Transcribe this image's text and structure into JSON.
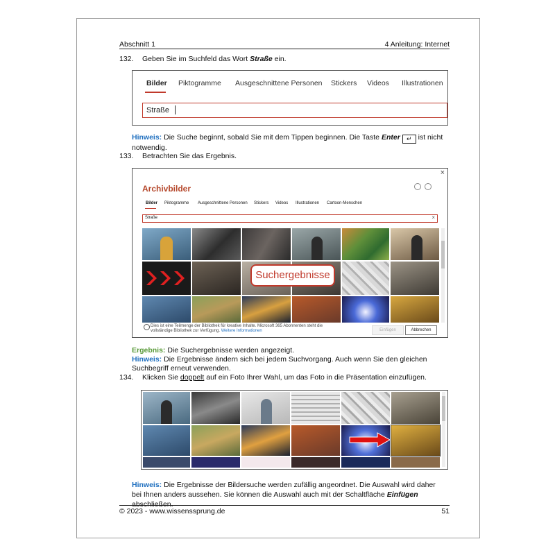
{
  "header": {
    "left": "Abschnitt 1",
    "right": "4 Anleitung: Internet"
  },
  "step132": {
    "num": "132.",
    "text_before": "Geben Sie im Suchfeld das Wort ",
    "bold_word": "Straße",
    "text_after": " ein."
  },
  "screen1": {
    "tabs": [
      "Bilder",
      "Piktogramme",
      "Ausgeschnittene Personen",
      "Stickers",
      "Videos",
      "Illustrationen"
    ],
    "search_value": "Straße"
  },
  "hint1": {
    "label": "Hinweis:",
    "text_before": " Die Suche beginnt, sobald Sie mit dem Tippen beginnen. Die Taste ",
    "key_word": "Enter",
    "key_symbol": "↵",
    "text_after": " ist nicht notwendig."
  },
  "step133": {
    "num": "133.",
    "text": "Betrachten Sie das Ergebnis."
  },
  "screen2": {
    "title": "Archivbilder",
    "close": "×",
    "tabs": [
      "Bilder",
      "Piktogramme",
      "Ausgeschnittene Personen",
      "Stickers",
      "Videos",
      "Illustrationen",
      "Cartoon-Menschen"
    ],
    "search_value": "Straße",
    "search_clear": "×",
    "callout": "Suchergebnisse",
    "footer_info": "Dies ist eine Teilmenge der Bibliothek für kreative Inhalte. Microsoft 365 Abonnenten steht die vollständige Bibliothek zur Verfügung.",
    "footer_link": "Weitere Informationen",
    "insert_button": "Einfügen",
    "cancel_button": "Abbrechen"
  },
  "result": {
    "label": "Ergebnis:",
    "text": " Die Suchergebnisse werden angezeigt."
  },
  "hint2": {
    "label": "Hinweis:",
    "text": " Die Ergebnisse ändern sich bei jedem Suchvorgang. Auch wenn Sie den gleichen Suchbegriff erneut verwenden."
  },
  "step134": {
    "num": "134.",
    "text_before": "Klicken Sie ",
    "underlined": "doppelt",
    "text_after": " auf ein Foto Ihrer Wahl, um das Foto in die Präsentation einzufügen."
  },
  "hint3": {
    "label": "Hinweis:",
    "text_before": " Die Ergebnisse der Bildersuche werden zufällig angeordnet. Die Auswahl wird daher bei Ihnen anders aussehen. Sie können die Auswahl auch mit der Schaltfläche ",
    "bold_word": "Einfügen",
    "text_after": " abschließen."
  },
  "footer": {
    "left": "© 2023 - www.wissenssprung.de",
    "right": "51"
  },
  "colors": {
    "accent": "#c0392b",
    "hint_blue": "#1f6fbf",
    "result_green": "#5a9a3a"
  }
}
